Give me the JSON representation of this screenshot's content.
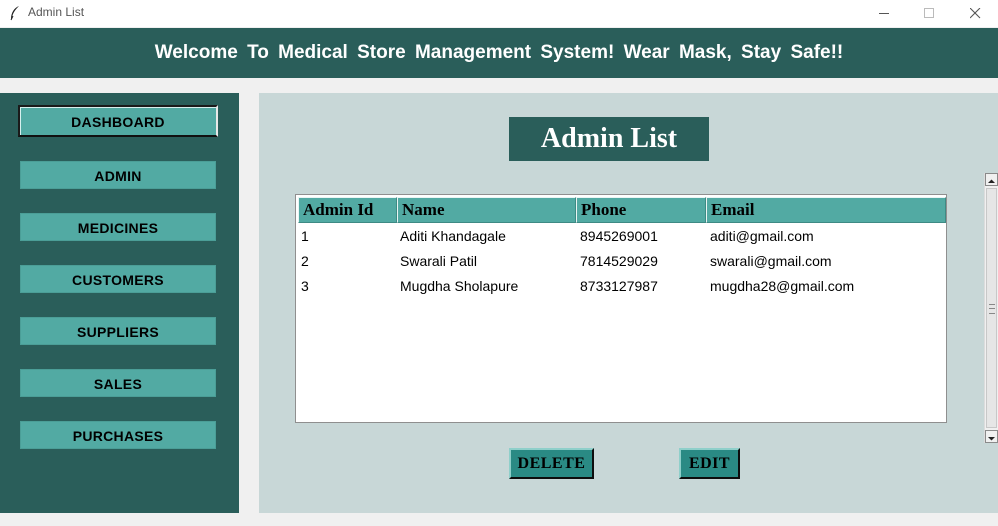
{
  "window": {
    "title": "Admin List",
    "icon": "feather-icon"
  },
  "banner": {
    "text": "Welcome To Medical Store Management System! Wear Mask, Stay Safe!!"
  },
  "sidebar": {
    "items": [
      {
        "label": "DASHBOARD"
      },
      {
        "label": "ADMIN"
      },
      {
        "label": "MEDICINES"
      },
      {
        "label": "CUSTOMERS"
      },
      {
        "label": "SUPPLIERS"
      },
      {
        "label": "SALES"
      },
      {
        "label": "PURCHASES"
      }
    ]
  },
  "main": {
    "heading": "Admin List",
    "table": {
      "columns": [
        "Admin Id",
        "Name",
        "Phone",
        "Email"
      ],
      "rows": [
        [
          "1",
          "Aditi Khandagale",
          "8945269001",
          "aditi@gmail.com"
        ],
        [
          "2",
          "Swarali Patil",
          "7814529029",
          "swarali@gmail.com"
        ],
        [
          "3",
          "Mugdha Sholapure",
          "8733127987",
          "mugdha28@gmail.com"
        ]
      ]
    },
    "buttons": {
      "delete": "DELETE",
      "edit": "EDIT"
    }
  },
  "colors": {
    "primary_dark": "#2a5e5a",
    "accent": "#52aaa3",
    "panel": "#c8d7d7",
    "action_button": "#2a8a84"
  }
}
